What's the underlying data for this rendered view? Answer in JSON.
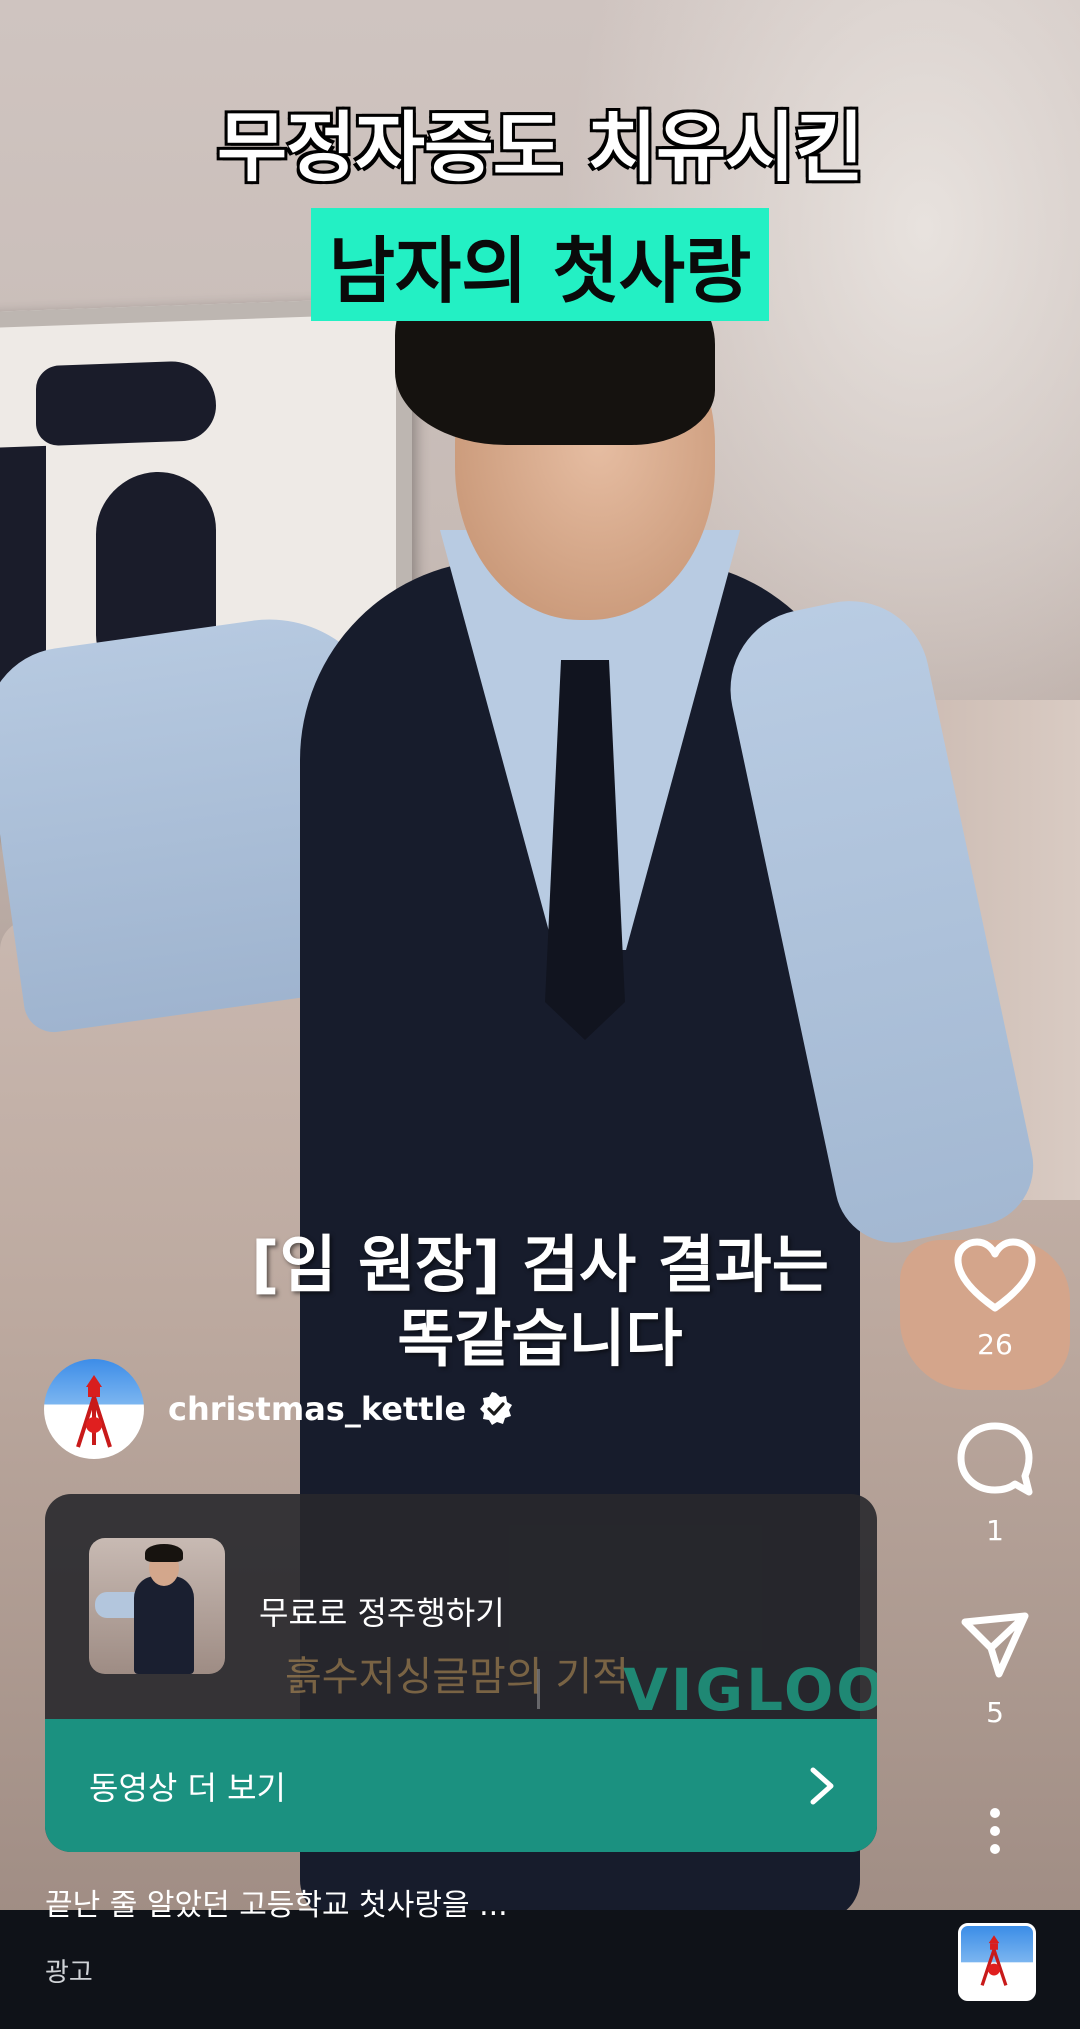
{
  "video": {
    "headline_line1": "무정자증도 치유시킨",
    "headline_line2": "남자의 첫사랑",
    "subtitle_line1": "[임 원장] 검사 결과는",
    "subtitle_line2": "똑같습니다",
    "highlight_color": "#23f0c4"
  },
  "actions": {
    "like_icon": "heart-icon",
    "like_count": "26",
    "comment_icon": "comment-bubble-icon",
    "comment_count": "1",
    "share_icon": "paper-plane-icon",
    "share_count": "5",
    "more_icon": "more-vertical-icon"
  },
  "account": {
    "username": "christmas_kettle",
    "verified_icon": "verified-badge-icon"
  },
  "ad": {
    "title": "무료로 정주행하기",
    "watermark_left": "흙수저싱글맘의 기적",
    "watermark_right": "VIGLOO",
    "cta_label": "동영상 더 보기",
    "cta_icon": "chevron-right-icon",
    "cta_color": "#1b9180"
  },
  "caption": {
    "description": "끝난 줄 알았던 고등학교 첫사랑을 ...",
    "sponsored_label": "광고"
  }
}
